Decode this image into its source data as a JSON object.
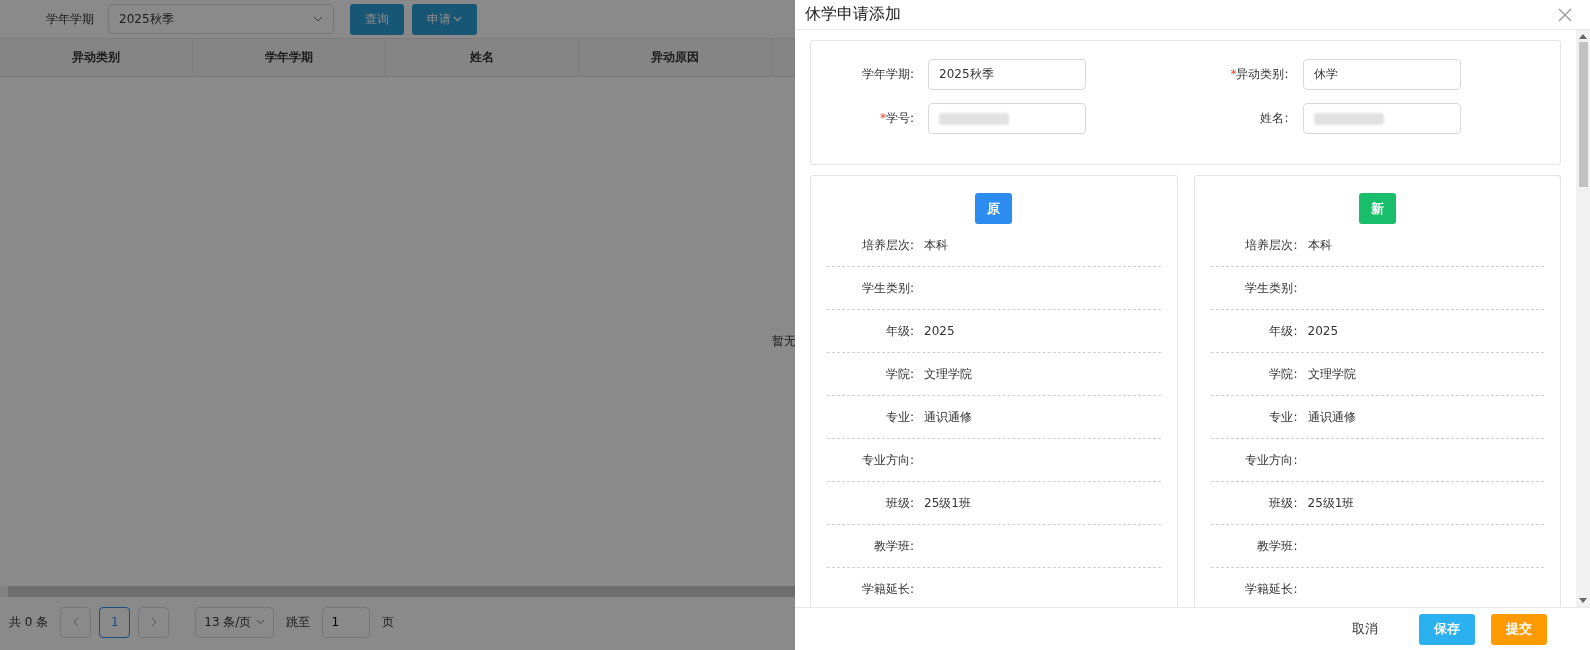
{
  "filter": {
    "label": "学年学期",
    "value": "2025秋季",
    "buttons": [
      {
        "label": "查询",
        "kind": "plain"
      },
      {
        "label": "申请",
        "kind": "dropdown"
      }
    ]
  },
  "table": {
    "columns": [
      "异动类别",
      "学年学期",
      "姓名",
      "异动原因"
    ],
    "empty_text": "暂无"
  },
  "pagination": {
    "total": "共 0 条",
    "pages": [
      {
        "label": "1",
        "selected": true
      }
    ],
    "page_size": "13 条/页",
    "jump_label": "跳至",
    "jump_value": "1",
    "page_suffix": "页"
  },
  "drawer": {
    "title": "休学申请添加",
    "fields": [
      {
        "label": "学年学期:",
        "value": "2025秋季",
        "redacted": false
      },
      {
        "label": "异动类别:",
        "required_mark": "*",
        "value": "休学",
        "redacted": false
      },
      {
        "label": "学号:",
        "required_mark": "*",
        "redacted": true
      },
      {
        "label": "姓名:",
        "redacted": true
      }
    ],
    "panels": [
      {
        "badge": "原",
        "color": "#2d8cf0",
        "rows": [
          {
            "label": "培养层次:",
            "value": "本科"
          },
          {
            "label": "学生类别:"
          },
          {
            "label": "年级:",
            "value": "2025"
          },
          {
            "label": "学院:",
            "value": "文理学院"
          },
          {
            "label": "专业:",
            "value": "通识通修"
          },
          {
            "label": "专业方向:"
          },
          {
            "label": "班级:",
            "value": "25级1班"
          },
          {
            "label": "教学班:"
          },
          {
            "label": "学籍延长:"
          }
        ]
      },
      {
        "badge": "新",
        "color": "#19be6b",
        "rows": [
          {
            "label": "培养层次:",
            "value": "本科"
          },
          {
            "label": "学生类别:"
          },
          {
            "label": "年级:",
            "value": "2025"
          },
          {
            "label": "学院:",
            "value": "文理学院"
          },
          {
            "label": "专业:",
            "value": "通识通修"
          },
          {
            "label": "专业方向:"
          },
          {
            "label": "班级:",
            "value": "25级1班"
          },
          {
            "label": "教学班:"
          },
          {
            "label": "学籍延长:"
          }
        ]
      }
    ],
    "footer": [
      {
        "label": "取消",
        "kind": "text"
      },
      {
        "label": "保存",
        "kind": "primary"
      },
      {
        "label": "提交",
        "kind": "warning"
      }
    ]
  }
}
